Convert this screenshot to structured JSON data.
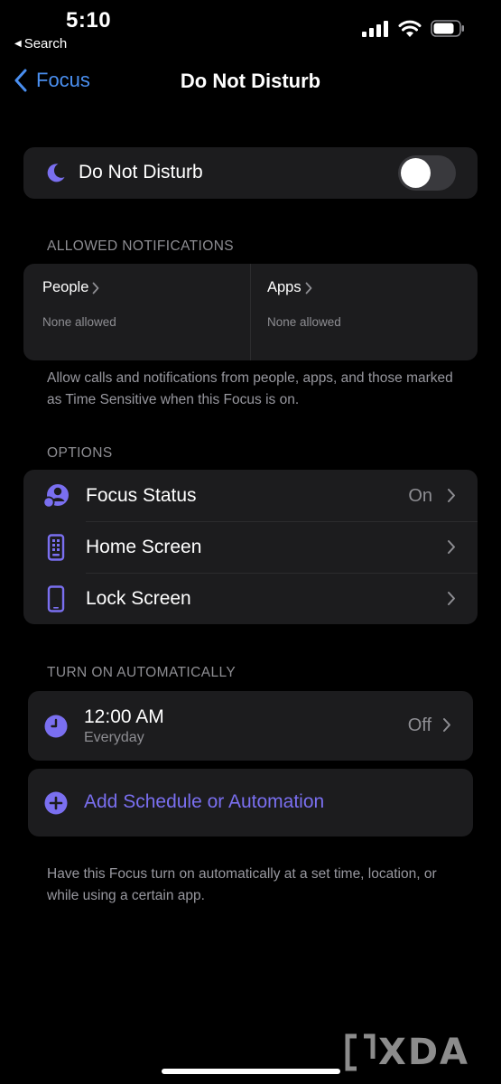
{
  "status_bar": {
    "time": "5:10",
    "back_app": "Search",
    "back_app_icon": "back-triangle-icon",
    "signal_icon": "cellular-signal-icon",
    "wifi_icon": "wifi-icon",
    "battery_icon": "battery-icon"
  },
  "nav": {
    "back_label": "Focus",
    "title": "Do Not Disturb"
  },
  "dnd": {
    "label": "Do Not Disturb",
    "icon": "moon-icon",
    "toggle_on": false
  },
  "allowed": {
    "header": "ALLOWED NOTIFICATIONS",
    "people": {
      "title": "People",
      "subtitle": "None allowed"
    },
    "apps": {
      "title": "Apps",
      "subtitle": "None allowed"
    },
    "footnote": "Allow calls and notifications from people, apps, and those marked as Time Sensitive when this Focus is on."
  },
  "options": {
    "header": "OPTIONS",
    "items": [
      {
        "label": "Focus Status",
        "value": "On",
        "icon": "focus-status-icon"
      },
      {
        "label": "Home Screen",
        "value": "",
        "icon": "home-screen-icon"
      },
      {
        "label": "Lock Screen",
        "value": "",
        "icon": "lock-screen-icon"
      }
    ]
  },
  "automatic": {
    "header": "TURN ON AUTOMATICALLY",
    "schedule": {
      "time": "12:00 AM",
      "subtitle": "Everyday",
      "value": "Off",
      "icon": "clock-icon"
    },
    "add_label": "Add Schedule or Automation",
    "add_icon": "plus-circle-icon",
    "footnote": "Have this Focus turn on automatically at a set time, location, or while using a certain app."
  },
  "colors": {
    "accent": "#7a6ff0",
    "link_blue": "#4a8ff0",
    "card_bg": "#1c1c1e",
    "secondary_text": "#8e8e93"
  }
}
